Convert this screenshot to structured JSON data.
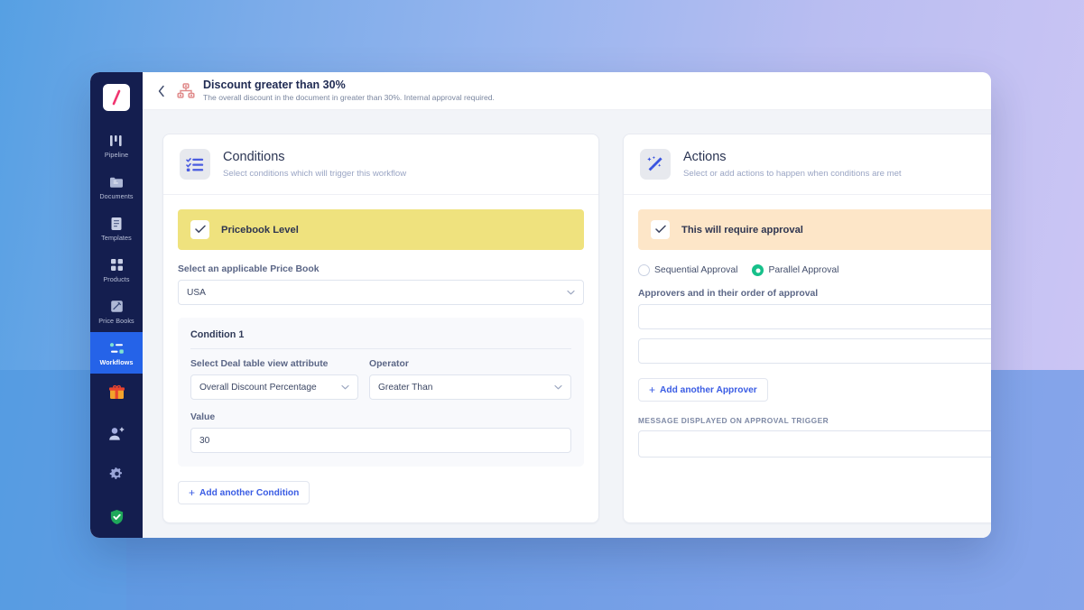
{
  "header": {
    "back_icon": "chevron-left-icon",
    "workflow_icon": "org-chart-icon",
    "title": "Discount greater than 30%",
    "subtitle": "The overall discount in the document in greater than 30%. Internal approval required."
  },
  "sidebar": {
    "logo": "slash-logo",
    "items": [
      {
        "label": "Pipeline",
        "icon": "pipeline-icon"
      },
      {
        "label": "Documents",
        "icon": "documents-icon"
      },
      {
        "label": "Templates",
        "icon": "templates-icon"
      },
      {
        "label": "Products",
        "icon": "products-icon"
      },
      {
        "label": "Price Books",
        "icon": "price-books-icon"
      },
      {
        "label": "Workflows",
        "icon": "workflows-icon",
        "active": true
      }
    ],
    "mini_items": [
      {
        "icon": "gift-icon"
      },
      {
        "icon": "add-user-icon"
      },
      {
        "icon": "gear-icon"
      },
      {
        "icon": "shield-check-icon"
      }
    ],
    "avatar": "user-avatar"
  },
  "conditions_panel": {
    "icon": "checklist-icon",
    "title": "Conditions",
    "subtitle": "Select conditions which will trigger this workflow",
    "block": {
      "label": "Pricebook Level",
      "checked": true,
      "check_icon": "check-icon",
      "color": "#efe27e"
    },
    "price_book": {
      "label": "Select an applicable Price Book",
      "value": "USA",
      "caret": "chevron-down-icon"
    },
    "condition": {
      "title": "Condition 1",
      "attribute": {
        "label": "Select Deal table view attribute",
        "value": "Overall Discount Percentage",
        "caret": "chevron-down-icon"
      },
      "operator": {
        "label": "Operator",
        "value": "Greater Than",
        "caret": "chevron-down-icon"
      },
      "value_field": {
        "label": "Value",
        "value": "30"
      }
    },
    "add_condition_label": "Add another Condition",
    "add_condition_plus": "+"
  },
  "actions_panel": {
    "icon": "magic-wand-icon",
    "title": "Actions",
    "subtitle": "Select or add actions to happen when conditions are met",
    "block": {
      "label": "This will require approval",
      "checked": true,
      "check_icon": "check-icon",
      "color": "#fde6c8"
    },
    "approval_mode": {
      "options": [
        {
          "label": "Sequential Approval",
          "selected": false
        },
        {
          "label": "Parallel Approval",
          "selected": true
        }
      ],
      "selected_color": "#17c08a"
    },
    "approvers": {
      "label": "Approvers and in their order of approval",
      "rows": [
        "",
        ""
      ]
    },
    "add_approver_label": "Add another Approver",
    "add_approver_plus": "+",
    "message": {
      "label": "MESSAGE DISPLAYED ON APPROVAL TRIGGER",
      "value": ""
    }
  }
}
